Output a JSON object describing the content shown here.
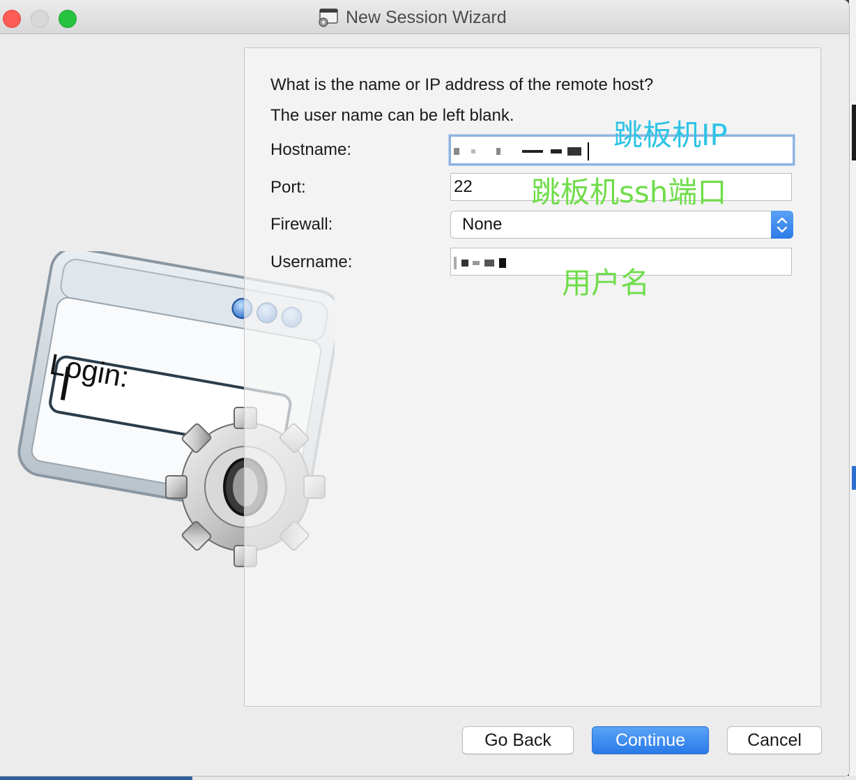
{
  "window": {
    "title": "New Session Wizard"
  },
  "illustration": {
    "login_label": "Login:"
  },
  "prompt": {
    "question": "What is the name or IP address of the remote host?",
    "hint": "The user name can be left blank."
  },
  "form": {
    "hostname_label": "Hostname:",
    "port_label": "Port:",
    "port_value": "22",
    "firewall_label": "Firewall:",
    "firewall_value": "None",
    "username_label": "Username:"
  },
  "annotations": {
    "hostname_note": "跳板机IP",
    "port_note": "跳板机ssh端口",
    "username_note": "用户名",
    "note_color_blue": "#2ec3e6",
    "note_color_green": "#6fdd4a"
  },
  "buttons": {
    "back": "Go Back",
    "continue": "Continue",
    "cancel": "Cancel"
  }
}
